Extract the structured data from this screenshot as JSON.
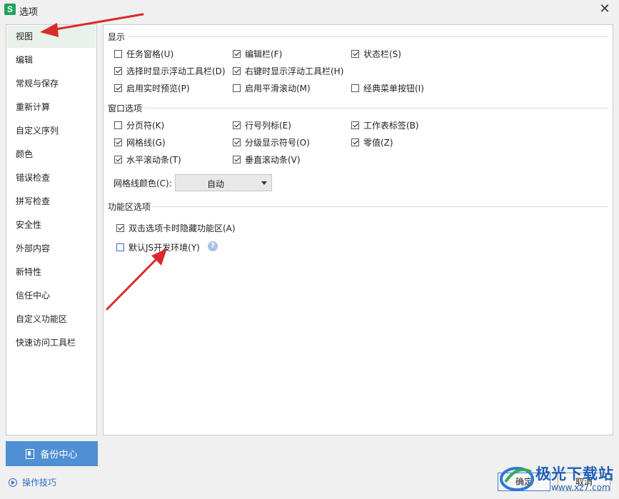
{
  "window": {
    "title": "选项",
    "app_icon_letter": "S",
    "close": "✕"
  },
  "sidebar": {
    "items": [
      "视图",
      "编辑",
      "常规与保存",
      "重新计算",
      "自定义序列",
      "颜色",
      "错误检查",
      "拼写检查",
      "安全性",
      "外部内容",
      "新特性",
      "信任中心",
      "自定义功能区",
      "快速访问工具栏"
    ],
    "active_index": 0
  },
  "display": {
    "section_label": "显示",
    "options": [
      {
        "label": "任务窗格(U)",
        "checked": false
      },
      {
        "label": "编辑栏(F)",
        "checked": true
      },
      {
        "label": "状态栏(S)",
        "checked": true
      },
      {
        "label": "选择时显示浮动工具栏(D)",
        "checked": true
      },
      {
        "label": "右键时显示浮动工具栏(H)",
        "checked": true
      },
      {
        "label": "启用实时预览(P)",
        "checked": true
      },
      {
        "label": "启用平滑滚动(M)",
        "checked": false
      },
      {
        "label": "经典菜单按钮(I)",
        "checked": false
      }
    ]
  },
  "window_options": {
    "section_label": "窗口选项",
    "options": [
      {
        "label": "分页符(K)",
        "checked": false
      },
      {
        "label": "行号列标(E)",
        "checked": true
      },
      {
        "label": "工作表标签(B)",
        "checked": true
      },
      {
        "label": "网格线(G)",
        "checked": true
      },
      {
        "label": "分级显示符号(O)",
        "checked": true
      },
      {
        "label": "零值(Z)",
        "checked": true
      },
      {
        "label": "水平滚动条(T)",
        "checked": true
      },
      {
        "label": "垂直滚动条(V)",
        "checked": true
      }
    ],
    "grid_color_label": "网格线颜色(C):",
    "grid_color_value": "自动"
  },
  "ribbon": {
    "section_label": "功能区选项",
    "options": [
      {
        "label": "双击选项卡时隐藏功能区(A)",
        "checked": true
      },
      {
        "label": "默认JS开发环境(Y)",
        "checked": false
      }
    ],
    "help": "?"
  },
  "footer": {
    "backup_label": "备份中心",
    "tips_label": "操作技巧",
    "ok_label": "确定",
    "cancel_label": "取消"
  },
  "watermark": {
    "text": "极光下载站",
    "url": "www.xz7.com"
  },
  "colors": {
    "accent": "#4f8fd3",
    "arrow": "#d92b2b",
    "active_bg": "#e8f1ea",
    "brand_green": "#1fa15f"
  }
}
